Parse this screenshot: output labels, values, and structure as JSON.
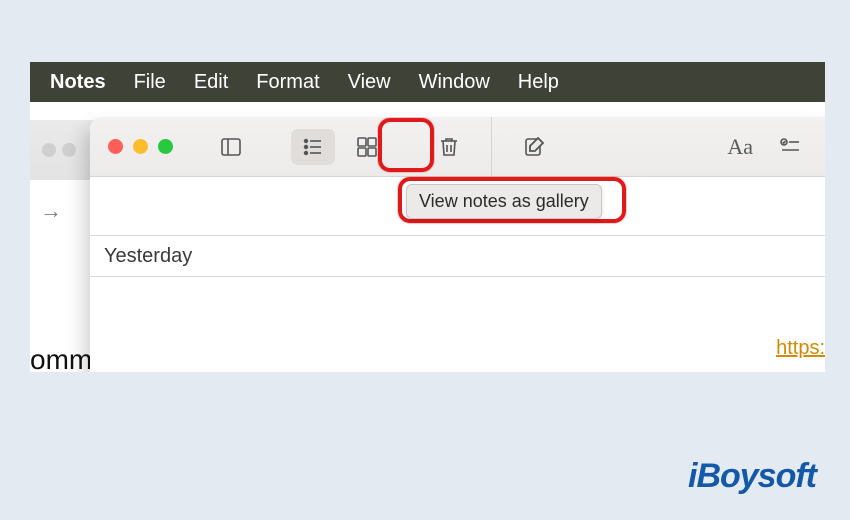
{
  "menubar": {
    "items": [
      "Notes",
      "File",
      "Edit",
      "Format",
      "View",
      "Window",
      "Help"
    ]
  },
  "traffic": {
    "red": "#ff5f57",
    "yellow": "#febc2e",
    "green": "#28c840"
  },
  "toolbar": {
    "sidebar_icon": "panel-left",
    "list_icon": "list",
    "gallery_icon": "grid",
    "trash_icon": "trash",
    "compose_icon": "compose",
    "font_label": "Aa",
    "checklist_icon": "checklist"
  },
  "tooltip": {
    "text": "View notes as gallery"
  },
  "section": {
    "header": "Yesterday"
  },
  "link": {
    "text": "https:"
  },
  "bg": {
    "omm": "omm",
    "arrow": "→"
  },
  "brand": {
    "text": "iBoysoft"
  }
}
